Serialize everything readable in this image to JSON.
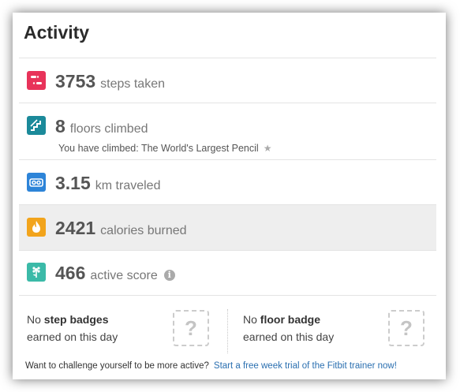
{
  "title": "Activity",
  "metrics": [
    {
      "value": "3753",
      "label": "steps taken",
      "icon": "footsteps-icon",
      "color": "#e8335a"
    },
    {
      "value": "8",
      "label": "floors climbed",
      "icon": "stairs-icon",
      "color": "#1b8a9a",
      "sub": "You have climbed: The World's Largest Pencil"
    },
    {
      "value": "3.15",
      "label": "km traveled",
      "icon": "distance-icon",
      "color": "#2d84d8"
    },
    {
      "value": "2421",
      "label": "calories burned",
      "icon": "flame-icon",
      "color": "#f2a41c"
    },
    {
      "value": "466",
      "label": "active score",
      "icon": "flower-icon",
      "color": "#3bbaa8",
      "info": "i"
    }
  ],
  "badges": {
    "step": {
      "pre": "No ",
      "bold": "step badges",
      "line2": "earned on this day",
      "placeholder": "?"
    },
    "floor": {
      "pre": "No ",
      "bold": "floor badge",
      "line2": "earned on this day",
      "placeholder": "?"
    }
  },
  "footer": {
    "text": "Want to challenge yourself to be more active?",
    "link": "Start a free week trial of the Fitbit trainer now!"
  }
}
